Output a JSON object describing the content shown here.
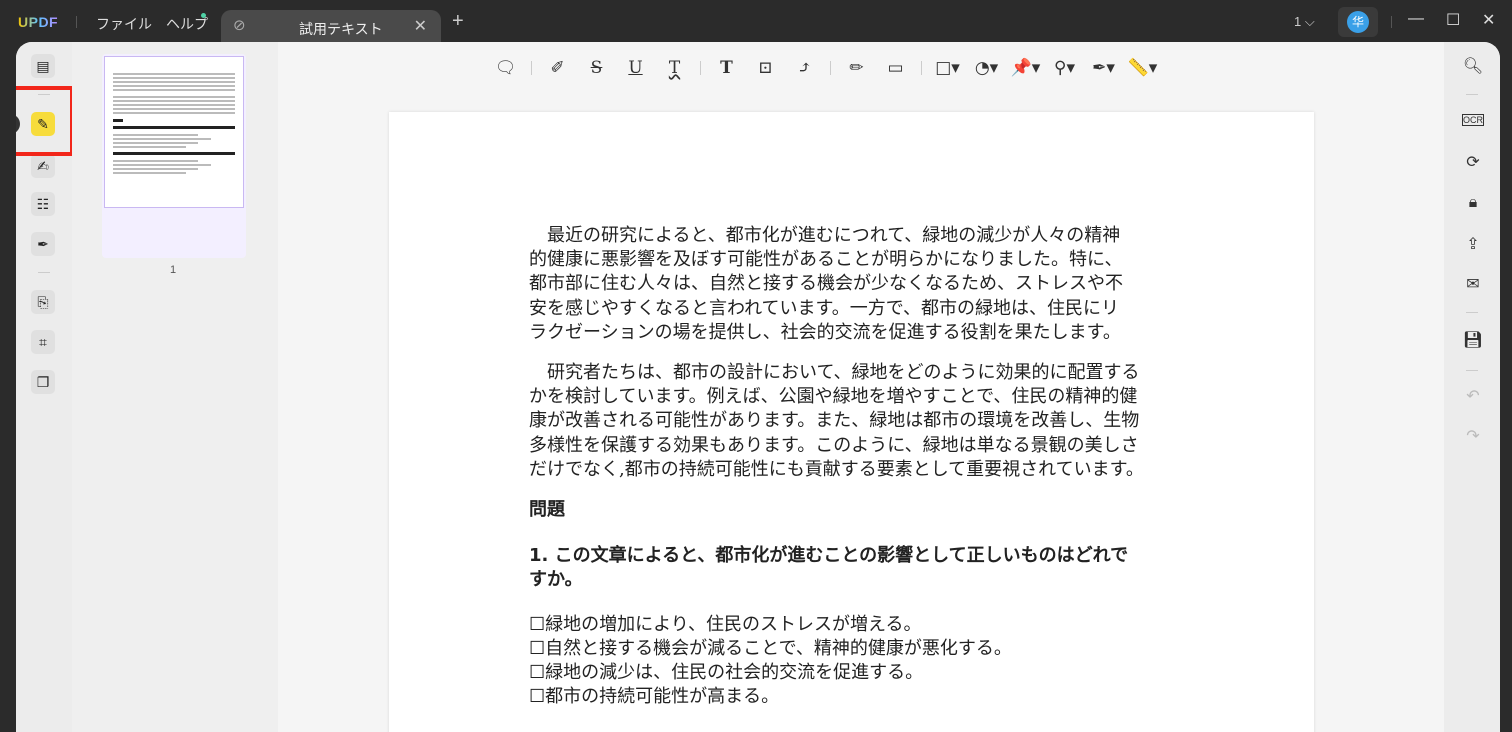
{
  "titlebar": {
    "logo": "UPDF",
    "menu": [
      "ファイル",
      "ヘルプ"
    ],
    "tab_title": "試用テキスト",
    "page_indicator": "1",
    "avatar_initial": "华"
  },
  "thumbnail": {
    "page_number": "1"
  },
  "document": {
    "paragraph1": [
      "　最近の研究によると、都市化が進むにつれて、緑地の減少が人々の精神",
      "的健康に悪影響を及ぼす可能性があることが明らかになりました。特に、",
      "都市部に住む人々は、自然と接する機会が少なくなるため、ストレスや不",
      "安を感じやすくなると言われています。一方で、都市の緑地は、住民にリ",
      "ラクゼーションの場を提供し、社会的交流を促進する役割を果たします。"
    ],
    "paragraph2": [
      "　研究者たちは、都市の設計において、緑地をどのように効果的に配置する",
      "かを検討しています。例えば、公園や緑地を増やすことで、住民の精神的健",
      "康が改善される可能性があります。また、緑地は都市の環境を改善し、生物",
      "多様性を保護する効果もあります。このように、緑地は単なる景観の美しさ",
      "だけでなく,都市の持続可能性にも貢献する要素として重要視されています。"
    ],
    "heading": "問題",
    "question": [
      "1.  この文章によると、都市化が進むことの影響として正しいものはどれで",
      "すか。"
    ],
    "options": [
      "☐緑地の増加により、住民のストレスが増える。",
      "☐自然と接する機会が減ることで、精神的健康が悪化する。",
      "☐緑地の減少は、住民の社会的交流を促進する。",
      "☐都市の持続可能性が高まる。"
    ]
  },
  "colors": {
    "accent_highlight": "#f7dc3c",
    "annotation_box": "#f2261a",
    "avatar": "#3aa0e8"
  }
}
